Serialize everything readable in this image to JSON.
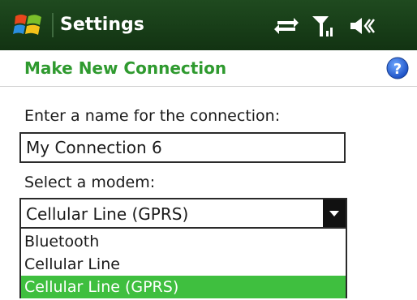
{
  "titlebar": {
    "title": "Settings",
    "icons": [
      "windows-start-icon",
      "data-sync-icon",
      "signal-strength-icon",
      "speaker-volume-icon"
    ]
  },
  "subheader": {
    "title": "Make New Connection",
    "help_icon": "help-icon"
  },
  "form": {
    "name_label": "Enter a name for the connection:",
    "name_value": "My Connection 6",
    "modem_label": "Select a modem:",
    "modem_selected": "Cellular Line (GPRS)",
    "modem_options": [
      "Bluetooth",
      "Cellular Line",
      "Cellular Line (GPRS)"
    ]
  },
  "colors": {
    "titlebar_bg": "#1f4a1f",
    "accent_green": "#2f9a2f",
    "selected_option_bg": "#3fbf3f"
  }
}
